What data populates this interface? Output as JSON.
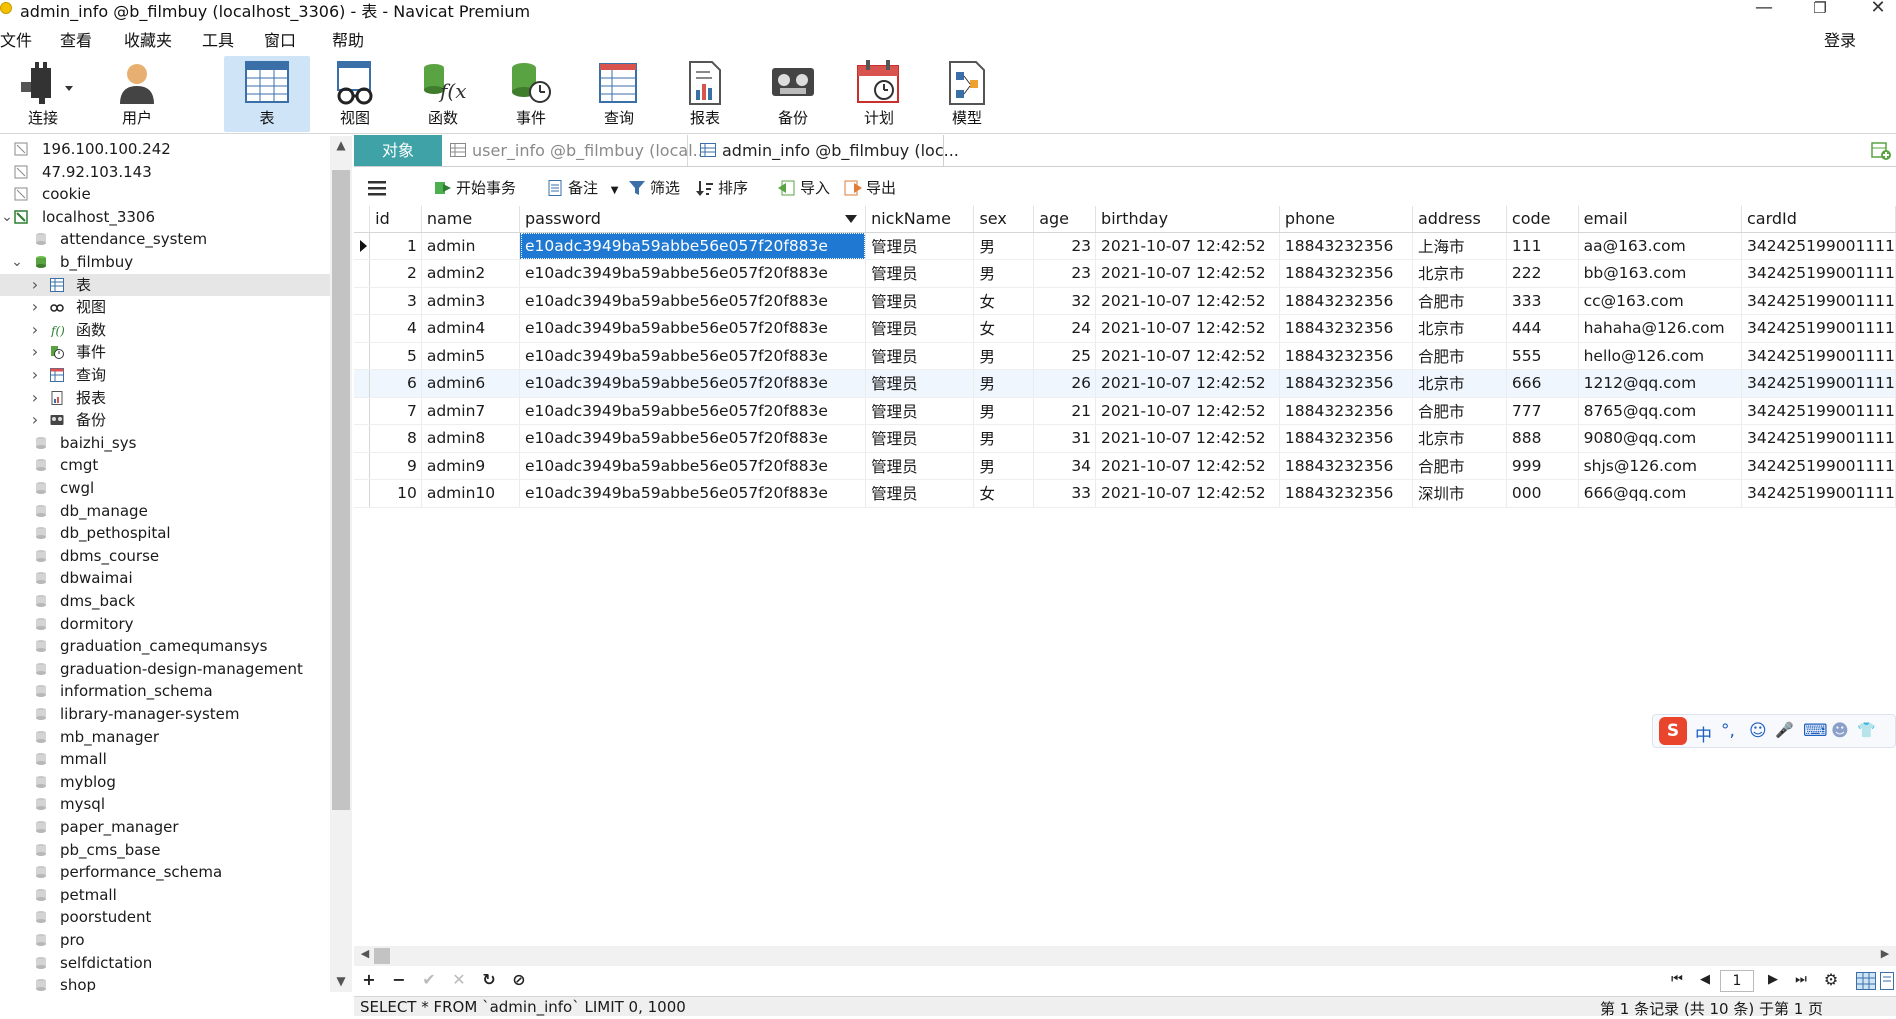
{
  "window": {
    "title": "admin_info @b_filmbuy (localhost_3306) - 表 - Navicat Premium",
    "minimize": "—",
    "restore": "❐",
    "close": "✕"
  },
  "menu": [
    "文件",
    "查看",
    "收藏夹",
    "工具",
    "窗口",
    "帮助"
  ],
  "login_label": "登录",
  "toolbar": [
    {
      "label": "连接",
      "icon": "connection-icon"
    },
    {
      "label": "用户",
      "icon": "user-icon"
    },
    {
      "label": "表",
      "icon": "table-icon"
    },
    {
      "label": "视图",
      "icon": "view-icon"
    },
    {
      "label": "函数",
      "icon": "function-icon"
    },
    {
      "label": "事件",
      "icon": "event-icon"
    },
    {
      "label": "查询",
      "icon": "query-icon"
    },
    {
      "label": "报表",
      "icon": "report-icon"
    },
    {
      "label": "备份",
      "icon": "backup-icon"
    },
    {
      "label": "计划",
      "icon": "schedule-icon"
    },
    {
      "label": "模型",
      "icon": "model-icon"
    }
  ],
  "tree": [
    {
      "label": "196.100.100.242",
      "type": "connection",
      "level": 0
    },
    {
      "label": "47.92.103.143",
      "type": "connection",
      "level": 0
    },
    {
      "label": "cookie",
      "type": "connection",
      "level": 0
    },
    {
      "label": "localhost_3306",
      "type": "connection-open",
      "level": 0
    },
    {
      "label": "attendance_system",
      "type": "database",
      "level": 1
    },
    {
      "label": "b_filmbuy",
      "type": "database-open",
      "level": 1
    },
    {
      "label": "表",
      "type": "table-node",
      "level": 2
    },
    {
      "label": "视图",
      "type": "view-node",
      "level": 2
    },
    {
      "label": "函数",
      "type": "function-node",
      "level": 2
    },
    {
      "label": "事件",
      "type": "event-node",
      "level": 2
    },
    {
      "label": "查询",
      "type": "query-node",
      "level": 2
    },
    {
      "label": "报表",
      "type": "report-node",
      "level": 2
    },
    {
      "label": "备份",
      "type": "backup-node",
      "level": 2
    },
    {
      "label": "baizhi_sys",
      "type": "database",
      "level": 1
    },
    {
      "label": "cmgt",
      "type": "database",
      "level": 1
    },
    {
      "label": "cwgl",
      "type": "database",
      "level": 1
    },
    {
      "label": "db_manage",
      "type": "database",
      "level": 1
    },
    {
      "label": "db_pethospital",
      "type": "database",
      "level": 1
    },
    {
      "label": "dbms_course",
      "type": "database",
      "level": 1
    },
    {
      "label": "dbwaimai",
      "type": "database",
      "level": 1
    },
    {
      "label": "dms_back",
      "type": "database",
      "level": 1
    },
    {
      "label": "dormitory",
      "type": "database",
      "level": 1
    },
    {
      "label": "graduation_camequmansys",
      "type": "database",
      "level": 1
    },
    {
      "label": "graduation-design-management",
      "type": "database",
      "level": 1
    },
    {
      "label": "information_schema",
      "type": "database",
      "level": 1
    },
    {
      "label": "library-manager-system",
      "type": "database",
      "level": 1
    },
    {
      "label": "mb_manager",
      "type": "database",
      "level": 1
    },
    {
      "label": "mmall",
      "type": "database",
      "level": 1
    },
    {
      "label": "myblog",
      "type": "database",
      "level": 1
    },
    {
      "label": "mysql",
      "type": "database",
      "level": 1
    },
    {
      "label": "paper_manager",
      "type": "database",
      "level": 1
    },
    {
      "label": "pb_cms_base",
      "type": "database",
      "level": 1
    },
    {
      "label": "performance_schema",
      "type": "database",
      "level": 1
    },
    {
      "label": "petmall",
      "type": "database",
      "level": 1
    },
    {
      "label": "poorstudent",
      "type": "database",
      "level": 1
    },
    {
      "label": "pro",
      "type": "database",
      "level": 1
    },
    {
      "label": "selfdictation",
      "type": "database",
      "level": 1
    },
    {
      "label": "shop",
      "type": "database",
      "level": 1
    }
  ],
  "tabs": {
    "objects": "对象",
    "user_info": "user_info @b_filmbuy (local...",
    "admin_info": "admin_info @b_filmbuy (loc..."
  },
  "data_tools": {
    "begin_transaction": "开始事务",
    "memo": "备注",
    "filter": "筛选",
    "sort": "排序",
    "import": "导入",
    "export": "导出"
  },
  "grid": {
    "columns": [
      "id",
      "name",
      "password",
      "nickName",
      "sex",
      "age",
      "birthday",
      "phone",
      "address",
      "code",
      "email",
      "cardId"
    ],
    "rows": [
      [
        "1",
        "admin",
        "e10adc3949ba59abbe56e057f20f883e",
        "管理员",
        "男",
        "23",
        "2021-10-07 12:42:52",
        "18843232356",
        "上海市",
        "111",
        "aa@163.com",
        "342425199001111"
      ],
      [
        "2",
        "admin2",
        "e10adc3949ba59abbe56e057f20f883e",
        "管理员",
        "男",
        "23",
        "2021-10-07 12:42:52",
        "18843232356",
        "北京市",
        "222",
        "bb@163.com",
        "342425199001111"
      ],
      [
        "3",
        "admin3",
        "e10adc3949ba59abbe56e057f20f883e",
        "管理员",
        "女",
        "32",
        "2021-10-07 12:42:52",
        "18843232356",
        "合肥市",
        "333",
        "cc@163.com",
        "342425199001111"
      ],
      [
        "4",
        "admin4",
        "e10adc3949ba59abbe56e057f20f883e",
        "管理员",
        "女",
        "24",
        "2021-10-07 12:42:52",
        "18843232356",
        "北京市",
        "444",
        "hahaha@126.com",
        "342425199001111"
      ],
      [
        "5",
        "admin5",
        "e10adc3949ba59abbe56e057f20f883e",
        "管理员",
        "男",
        "25",
        "2021-10-07 12:42:52",
        "18843232356",
        "合肥市",
        "555",
        "hello@126.com",
        "342425199001111"
      ],
      [
        "6",
        "admin6",
        "e10adc3949ba59abbe56e057f20f883e",
        "管理员",
        "男",
        "26",
        "2021-10-07 12:42:52",
        "18843232356",
        "北京市",
        "666",
        "1212@qq.com",
        "342425199001111"
      ],
      [
        "7",
        "admin7",
        "e10adc3949ba59abbe56e057f20f883e",
        "管理员",
        "男",
        "21",
        "2021-10-07 12:42:52",
        "18843232356",
        "合肥市",
        "777",
        "8765@qq.com",
        "342425199001111"
      ],
      [
        "8",
        "admin8",
        "e10adc3949ba59abbe56e057f20f883e",
        "管理员",
        "男",
        "31",
        "2021-10-07 12:42:52",
        "18843232356",
        "北京市",
        "888",
        "9080@qq.com",
        "342425199001111"
      ],
      [
        "9",
        "admin9",
        "e10adc3949ba59abbe56e057f20f883e",
        "管理员",
        "男",
        "34",
        "2021-10-07 12:42:52",
        "18843232356",
        "合肥市",
        "999",
        "shjs@126.com",
        "342425199001111"
      ],
      [
        "10",
        "admin10",
        "e10adc3949ba59abbe56e057f20f883e",
        "管理员",
        "女",
        "33",
        "2021-10-07 12:42:52",
        "18843232356",
        "深圳市",
        "000",
        "666@qq.com",
        "342425199001111"
      ]
    ]
  },
  "nav": {
    "add": "+",
    "delete": "−",
    "apply": "✔",
    "discard": "✕",
    "refresh": "↻",
    "stop": "⊘",
    "first": "⏮",
    "prev": "◀",
    "page": "1",
    "next": "▶",
    "last": "⏭",
    "settings": "⚙"
  },
  "status": {
    "sql": "SELECT * FROM `admin_info` LIMIT 0, 1000",
    "summary": "第 1 条记录 (共 10 条) 于第 1 页"
  },
  "ime": {
    "logo": "S",
    "mode": "中",
    "punct": "°,",
    "emoji": "☺",
    "mic": "🎤",
    "keyboard": "⌨",
    "tools": "👕"
  },
  "colors": {
    "accent": "#3ea2a6",
    "selection": "#1f78d1",
    "toolbar_active": "#cfe4f7",
    "db_green": "#4caf50"
  }
}
